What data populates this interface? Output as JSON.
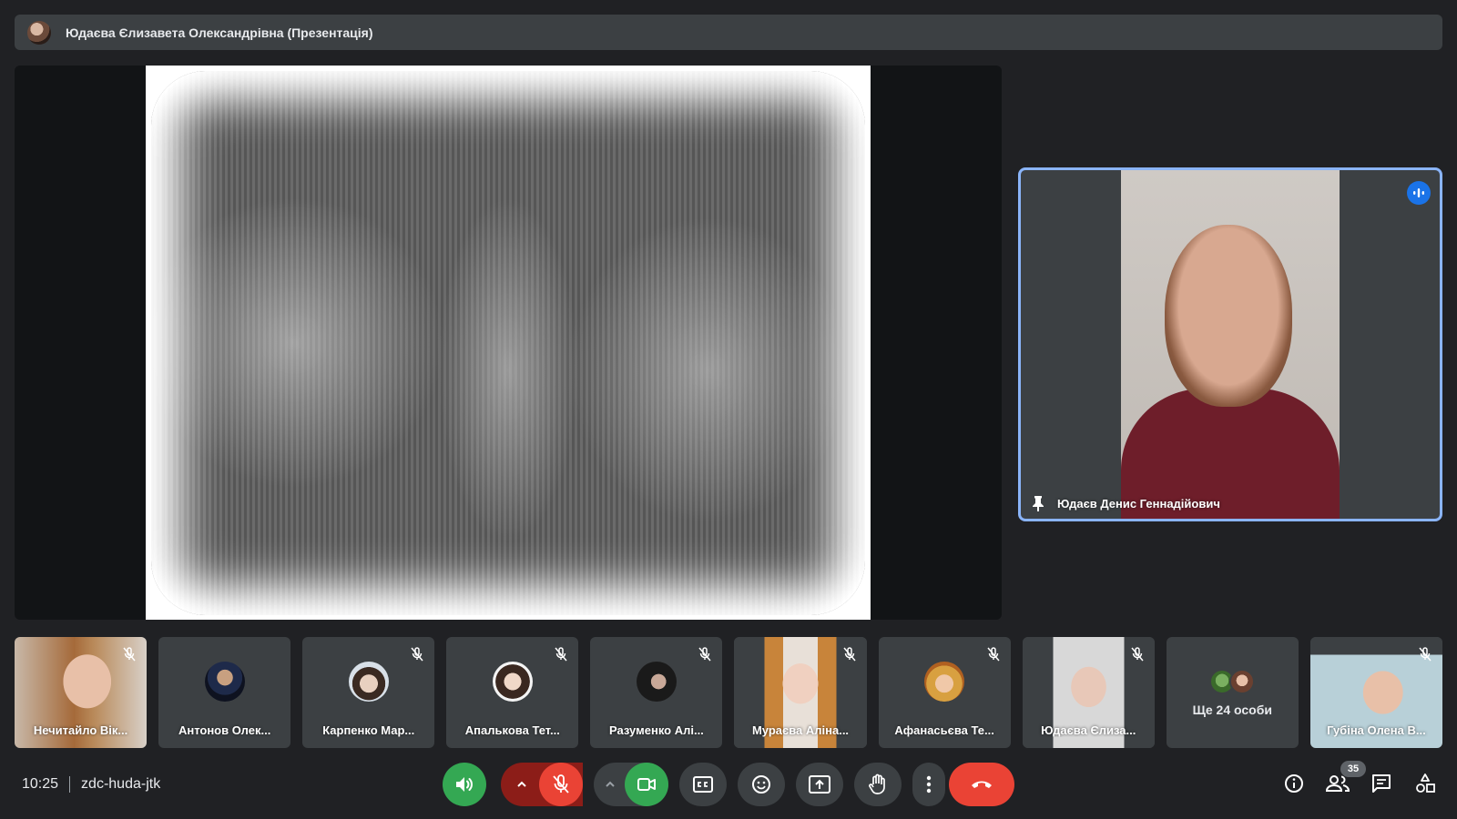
{
  "presenter": {
    "name": "Юдаєва Єлизавета Олександрівна (Презентація)"
  },
  "stage": {
    "content": "presentation-slide"
  },
  "speaker": {
    "name": "Юдаєв Денис Геннадійович",
    "pinned": true,
    "speaking": true
  },
  "participants": [
    {
      "name": "Нечитайло Вік...",
      "muted": true,
      "video": true
    },
    {
      "name": "Антонов Олек...",
      "muted": false,
      "video": false
    },
    {
      "name": "Карпенко Мар...",
      "muted": true,
      "video": false
    },
    {
      "name": "Апалькова Тет...",
      "muted": true,
      "video": false
    },
    {
      "name": "Разуменко Алі...",
      "muted": true,
      "video": false
    },
    {
      "name": "Мураєва Аліна...",
      "muted": true,
      "video": true
    },
    {
      "name": "Афанасьєва Те...",
      "muted": true,
      "video": false
    },
    {
      "name": "Юдаєва Єлиза...",
      "muted": true,
      "video": true
    },
    {
      "name": "Губіна Олена В...",
      "muted": true,
      "video": true
    }
  ],
  "more_participants": {
    "label": "Ще 24 особи"
  },
  "meeting": {
    "time": "10:25",
    "code": "zdc-huda-jtk",
    "participant_count": "35"
  },
  "colors": {
    "background": "#202124",
    "tile": "#3c4043",
    "active_border": "#8ab4f8",
    "speaking_blue": "#1a73e8",
    "green": "#34a853",
    "red": "#ea4335",
    "dark_red": "#8c1d18"
  },
  "controls": {
    "audio_output": "volume-icon",
    "mic": "mic-off-icon",
    "camera": "videocam-icon",
    "captions": "closed-caption-icon",
    "reactions": "emoji-icon",
    "present": "present-screen-icon",
    "raise_hand": "hand-icon",
    "more": "more-vert-icon",
    "leave": "call-end-icon",
    "info": "info-icon",
    "people": "people-icon",
    "chat": "chat-icon",
    "activities": "activities-icon"
  }
}
